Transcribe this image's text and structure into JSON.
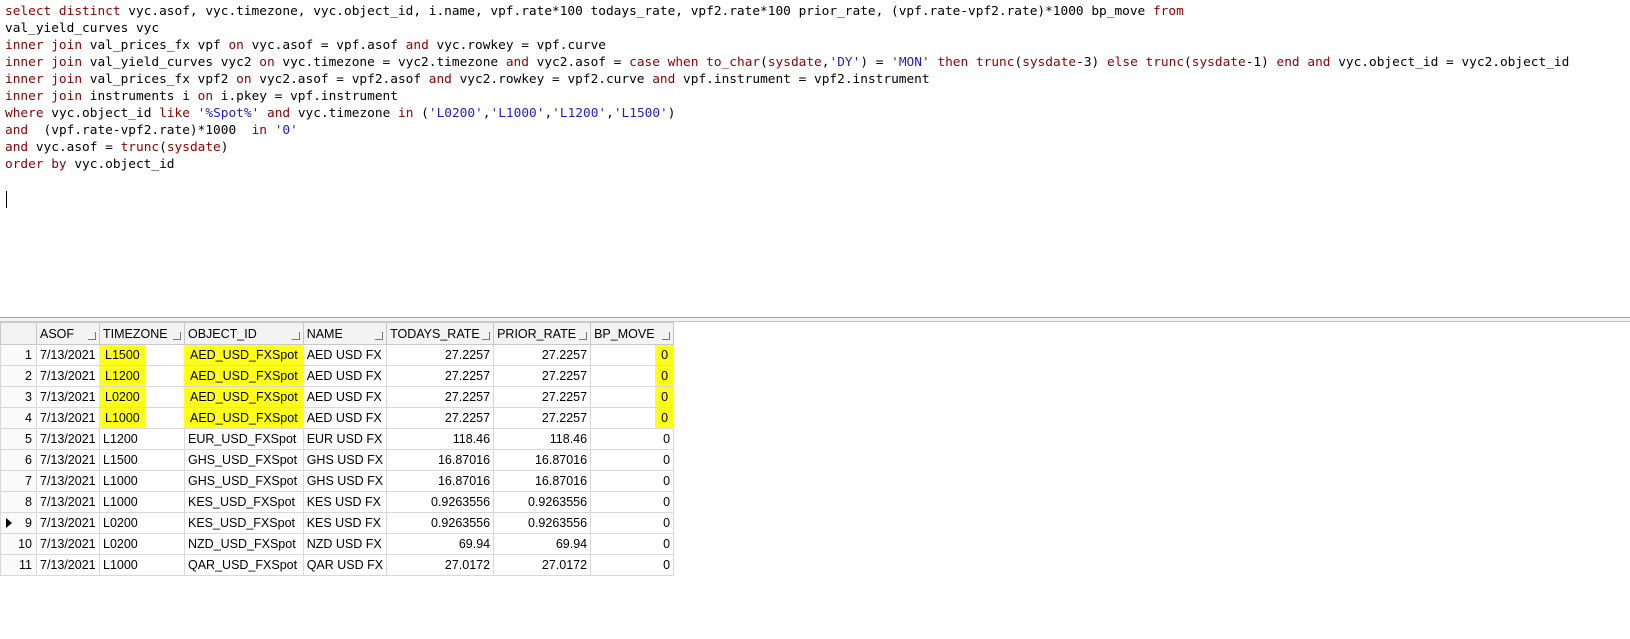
{
  "editor": {
    "lines": [
      [
        [
          "kw",
          "select distinct"
        ],
        [
          "id",
          " vyc.asof, vyc.timezone, vyc.object_id, i.name, vpf.rate*100 todays_rate, vpf2.rate*100 prior_rate, (vpf.rate-vpf2.rate)*1000 bp_move "
        ],
        [
          "kw",
          "from"
        ]
      ],
      [
        [
          "id",
          "val_yield_curves vyc"
        ]
      ],
      [
        [
          "kw",
          "inner join"
        ],
        [
          "id",
          " val_prices_fx vpf "
        ],
        [
          "kw",
          "on"
        ],
        [
          "id",
          " vyc.asof = vpf.asof "
        ],
        [
          "kw",
          "and"
        ],
        [
          "id",
          " vyc.rowkey = vpf.curve"
        ]
      ],
      [
        [
          "kw",
          "inner join"
        ],
        [
          "id",
          " val_yield_curves vyc2 "
        ],
        [
          "kw",
          "on"
        ],
        [
          "id",
          " vyc.timezone = vyc2.timezone "
        ],
        [
          "kw",
          "and"
        ],
        [
          "id",
          " vyc2.asof = "
        ],
        [
          "kw",
          "case when"
        ],
        [
          "id",
          " "
        ],
        [
          "kw",
          "to_char"
        ],
        [
          "id",
          "("
        ],
        [
          "kw",
          "sysdate"
        ],
        [
          "id",
          ","
        ],
        [
          "str",
          "'DY'"
        ],
        [
          "id",
          ") = "
        ],
        [
          "str",
          "'MON'"
        ],
        [
          "id",
          " "
        ],
        [
          "kw",
          "then"
        ],
        [
          "id",
          " "
        ],
        [
          "kw",
          "trunc"
        ],
        [
          "id",
          "("
        ],
        [
          "kw",
          "sysdate"
        ],
        [
          "id",
          "-3) "
        ],
        [
          "kw",
          "else"
        ],
        [
          "id",
          " "
        ],
        [
          "kw",
          "trunc"
        ],
        [
          "id",
          "("
        ],
        [
          "kw",
          "sysdate"
        ],
        [
          "id",
          "-1) "
        ],
        [
          "kw",
          "end"
        ],
        [
          "id",
          " "
        ],
        [
          "kw",
          "and"
        ],
        [
          "id",
          " vyc.object_id = vyc2.object_id"
        ]
      ],
      [
        [
          "kw",
          "inner join"
        ],
        [
          "id",
          " val_prices_fx vpf2 "
        ],
        [
          "kw",
          "on"
        ],
        [
          "id",
          " vyc2.asof = vpf2.asof "
        ],
        [
          "kw",
          "and"
        ],
        [
          "id",
          " vyc2.rowkey = vpf2.curve "
        ],
        [
          "kw",
          "and"
        ],
        [
          "id",
          " vpf.instrument = vpf2.instrument"
        ]
      ],
      [
        [
          "kw",
          "inner join"
        ],
        [
          "id",
          " instruments i "
        ],
        [
          "kw",
          "on"
        ],
        [
          "id",
          " i.pkey = vpf.instrument"
        ]
      ],
      [
        [
          "kw",
          "where"
        ],
        [
          "id",
          " vyc.object_id "
        ],
        [
          "kw",
          "like"
        ],
        [
          "id",
          " "
        ],
        [
          "str",
          "'%Spot%'"
        ],
        [
          "id",
          " "
        ],
        [
          "kw",
          "and"
        ],
        [
          "id",
          " vyc.timezone "
        ],
        [
          "kw",
          "in"
        ],
        [
          "id",
          " ("
        ],
        [
          "str",
          "'L0200'"
        ],
        [
          "id",
          ","
        ],
        [
          "str",
          "'L1000'"
        ],
        [
          "id",
          ","
        ],
        [
          "str",
          "'L1200'"
        ],
        [
          "id",
          ","
        ],
        [
          "str",
          "'L1500'"
        ],
        [
          "id",
          ")"
        ]
      ],
      [
        [
          "kw",
          "and"
        ],
        [
          "id",
          "  (vpf.rate-vpf2.rate)*1000  "
        ],
        [
          "kw",
          "in"
        ],
        [
          "id",
          " "
        ],
        [
          "str",
          "'0'"
        ]
      ],
      [
        [
          "kw",
          "and"
        ],
        [
          "id",
          " vyc.asof = "
        ],
        [
          "kw",
          "trunc"
        ],
        [
          "id",
          "("
        ],
        [
          "kw",
          "sysdate"
        ],
        [
          "id",
          ")"
        ]
      ],
      [
        [
          "kw",
          "order by"
        ],
        [
          "id",
          " vyc.object_id"
        ]
      ]
    ]
  },
  "grid": {
    "columns": [
      "ASOF",
      "TIMEZONE",
      "OBJECT_ID",
      "NAME",
      "TODAYS_RATE",
      "PRIOR_RATE",
      "BP_MOVE"
    ],
    "rows": [
      {
        "n": "1",
        "cells": [
          "7/13/2021",
          "L1500",
          "AED_USD_FXSpot",
          "AED USD FX",
          "27.2257",
          "27.2257",
          "0"
        ],
        "hl": true
      },
      {
        "n": "2",
        "cells": [
          "7/13/2021",
          "L1200",
          "AED_USD_FXSpot",
          "AED USD FX",
          "27.2257",
          "27.2257",
          "0"
        ],
        "hl": true
      },
      {
        "n": "3",
        "cells": [
          "7/13/2021",
          "L0200",
          "AED_USD_FXSpot",
          "AED USD FX",
          "27.2257",
          "27.2257",
          "0"
        ],
        "hl": true
      },
      {
        "n": "4",
        "cells": [
          "7/13/2021",
          "L1000",
          "AED_USD_FXSpot",
          "AED USD FX",
          "27.2257",
          "27.2257",
          "0"
        ],
        "hl": true
      },
      {
        "n": "5",
        "cells": [
          "7/13/2021",
          "L1200",
          "EUR_USD_FXSpot",
          "EUR USD FX",
          "118.46",
          "118.46",
          "0"
        ],
        "hl": false
      },
      {
        "n": "6",
        "cells": [
          "7/13/2021",
          "L1500",
          "GHS_USD_FXSpot",
          "GHS USD FX",
          "16.87016",
          "16.87016",
          "0"
        ],
        "hl": false
      },
      {
        "n": "7",
        "cells": [
          "7/13/2021",
          "L1000",
          "GHS_USD_FXSpot",
          "GHS USD FX",
          "16.87016",
          "16.87016",
          "0"
        ],
        "hl": false
      },
      {
        "n": "8",
        "cells": [
          "7/13/2021",
          "L1000",
          "KES_USD_FXSpot",
          "KES USD FX",
          "0.9263556",
          "0.9263556",
          "0"
        ],
        "hl": false
      },
      {
        "n": "9",
        "cells": [
          "7/13/2021",
          "L0200",
          "KES_USD_FXSpot",
          "KES USD FX",
          "0.9263556",
          "0.9263556",
          "0"
        ],
        "hl": false,
        "current": true
      },
      {
        "n": "10",
        "cells": [
          "7/13/2021",
          "L0200",
          "NZD_USD_FXSpot",
          "NZD USD FX",
          "69.94",
          "69.94",
          "0"
        ],
        "hl": false
      },
      {
        "n": "11",
        "cells": [
          "7/13/2021",
          "L1000",
          "QAR_USD_FXSpot",
          "QAR USD FX",
          "27.0172",
          "27.0172",
          "0"
        ],
        "hl": false
      }
    ]
  },
  "colors": {
    "keyword": "#8b0000",
    "string": "#1f1fbf",
    "highlight": "#ffff1a"
  }
}
